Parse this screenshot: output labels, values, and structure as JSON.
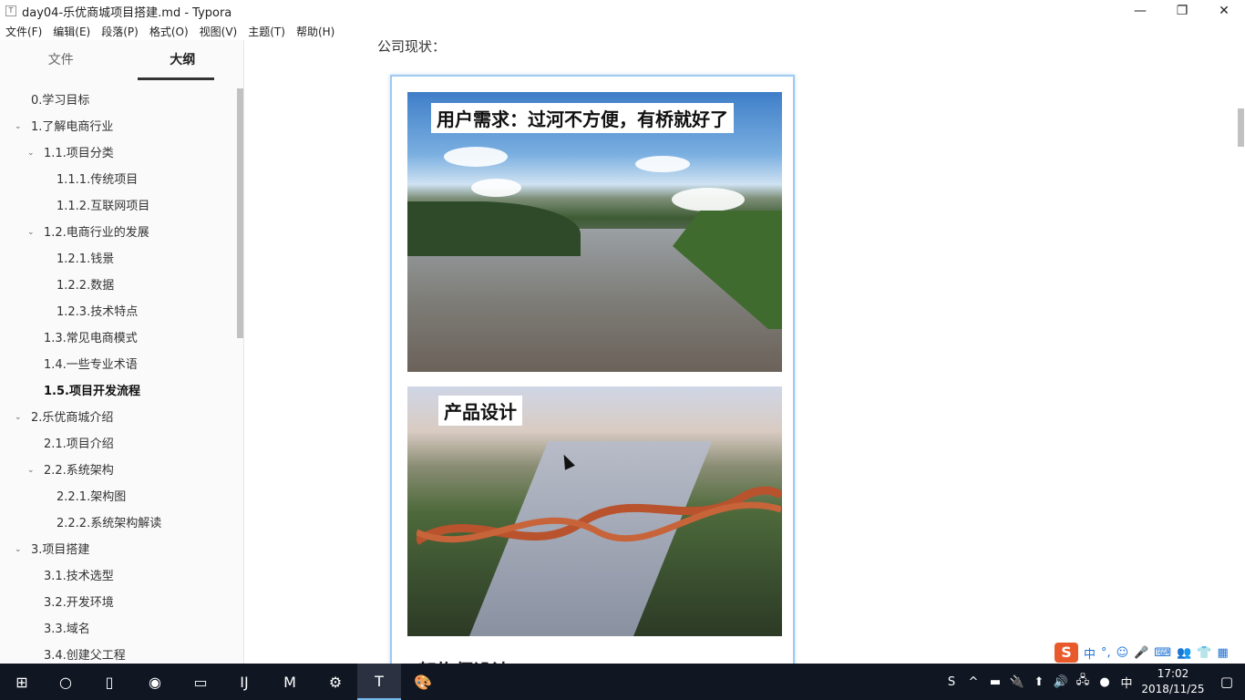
{
  "window": {
    "title": "day04-乐优商城项目搭建.md - Typora",
    "app_icon_glyph": "T",
    "minimize_glyph": "—",
    "maximize_glyph": "❐",
    "close_glyph": "✕"
  },
  "menubar": {
    "items": [
      "文件(F)",
      "编辑(E)",
      "段落(P)",
      "格式(O)",
      "视图(V)",
      "主题(T)",
      "帮助(H)"
    ]
  },
  "sidebar": {
    "tabs": [
      "文件",
      "大纲"
    ],
    "active_tab": "大纲",
    "outline": [
      {
        "label": "0.学习目标",
        "level": 1,
        "collapsible": false,
        "active": false
      },
      {
        "label": "1.了解电商行业",
        "level": 1,
        "collapsible": true,
        "active": false
      },
      {
        "label": "1.1.项目分类",
        "level": 2,
        "collapsible": true,
        "active": false
      },
      {
        "label": "1.1.1.传统项目",
        "level": 3,
        "collapsible": false,
        "active": false
      },
      {
        "label": "1.1.2.互联网项目",
        "level": 3,
        "collapsible": false,
        "active": false
      },
      {
        "label": "1.2.电商行业的发展",
        "level": 2,
        "collapsible": true,
        "active": false
      },
      {
        "label": "1.2.1.钱景",
        "level": 3,
        "collapsible": false,
        "active": false
      },
      {
        "label": "1.2.2.数据",
        "level": 3,
        "collapsible": false,
        "active": false
      },
      {
        "label": "1.2.3.技术特点",
        "level": 3,
        "collapsible": false,
        "active": false
      },
      {
        "label": "1.3.常见电商模式",
        "level": 2,
        "collapsible": false,
        "active": false
      },
      {
        "label": "1.4.一些专业术语",
        "level": 2,
        "collapsible": false,
        "active": false
      },
      {
        "label": "1.5.项目开发流程",
        "level": 2,
        "collapsible": false,
        "active": true
      },
      {
        "label": "2.乐优商城介绍",
        "level": 1,
        "collapsible": true,
        "active": false
      },
      {
        "label": "2.1.项目介绍",
        "level": 2,
        "collapsible": false,
        "active": false
      },
      {
        "label": "2.2.系统架构",
        "level": 2,
        "collapsible": true,
        "active": false
      },
      {
        "label": "2.2.1.架构图",
        "level": 3,
        "collapsible": false,
        "active": false
      },
      {
        "label": "2.2.2.系统架构解读",
        "level": 3,
        "collapsible": false,
        "active": false
      },
      {
        "label": "3.项目搭建",
        "level": 1,
        "collapsible": true,
        "active": false
      },
      {
        "label": "3.1.技术选型",
        "level": 2,
        "collapsible": false,
        "active": false
      },
      {
        "label": "3.2.开发环境",
        "level": 2,
        "collapsible": false,
        "active": false
      },
      {
        "label": "3.3.域名",
        "level": 2,
        "collapsible": false,
        "active": false
      },
      {
        "label": "3.4.创建父工程",
        "level": 2,
        "collapsible": false,
        "active": false
      }
    ],
    "footer": {
      "back_glyph": "‹",
      "source_glyph": "</>"
    }
  },
  "document": {
    "heading_partial": "公司现状：",
    "image1_caption": "用户需求：过河不方便，有桥就好了",
    "image2_caption": "产品设计",
    "next_heading_partial": "架构师设计"
  },
  "ime": {
    "logo": "S",
    "mode": "中",
    "icons": [
      "°,",
      "☺",
      "🎤",
      "⌨",
      "👥",
      "👕",
      "▦"
    ]
  },
  "taskbar": {
    "apps": [
      {
        "name": "start",
        "glyph": "⊞",
        "active": false
      },
      {
        "name": "search",
        "glyph": "○",
        "active": false
      },
      {
        "name": "task-view",
        "glyph": "▯",
        "active": false
      },
      {
        "name": "chrome",
        "glyph": "◉",
        "active": false
      },
      {
        "name": "explorer",
        "glyph": "▭",
        "active": false
      },
      {
        "name": "intellij",
        "glyph": "IJ",
        "active": false
      },
      {
        "name": "maxthon",
        "glyph": "M",
        "active": false
      },
      {
        "name": "tool",
        "glyph": "⚙",
        "active": false
      },
      {
        "name": "typora",
        "glyph": "T",
        "active": true
      },
      {
        "name": "paint",
        "glyph": "🎨",
        "active": false
      }
    ],
    "tray_icons": [
      "S",
      "^",
      "▬",
      "🔌",
      "⬆",
      "🔊",
      "🖧",
      "●",
      "中"
    ],
    "time": "17:02",
    "date": "2018/11/25",
    "notification_glyph": "▢"
  }
}
